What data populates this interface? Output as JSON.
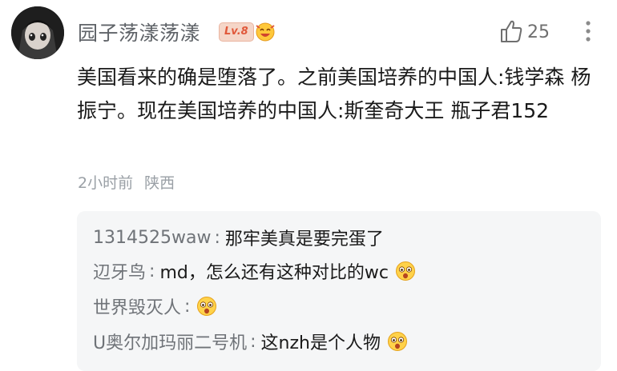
{
  "comment": {
    "username": "园子荡漾荡漾",
    "level": "Lv.8",
    "like_count": "25",
    "text": "美国看来的确是堕落了。之前美国培养的中国人:钱学森 杨振宁。现在美国培养的中国人:斯奎奇大王 瓶子君152",
    "time": "2小时前",
    "location": "陕西"
  },
  "replies": [
    {
      "name": "1314525waw",
      "text": "那牢美真是要完蛋了",
      "emoji": ""
    },
    {
      "name": "辺牙鸟",
      "text": "md，怎么还有这种对比的wc",
      "emoji": "surprised-face-emoji"
    },
    {
      "name": "世界毁灭人",
      "text": "",
      "emoji": "surprised-face-emoji"
    },
    {
      "name": "U奥尔加玛丽二号机",
      "text": "这nzh是个人物",
      "emoji": "surprised-face-emoji"
    }
  ],
  "reply_separator": ":",
  "colors": {
    "username": "#5f6368",
    "level_badge_bg": "#f5d6c8",
    "level_badge_text": "#e0583a",
    "meta": "#9aa0a6",
    "reply_bg": "#f5f6f7"
  }
}
